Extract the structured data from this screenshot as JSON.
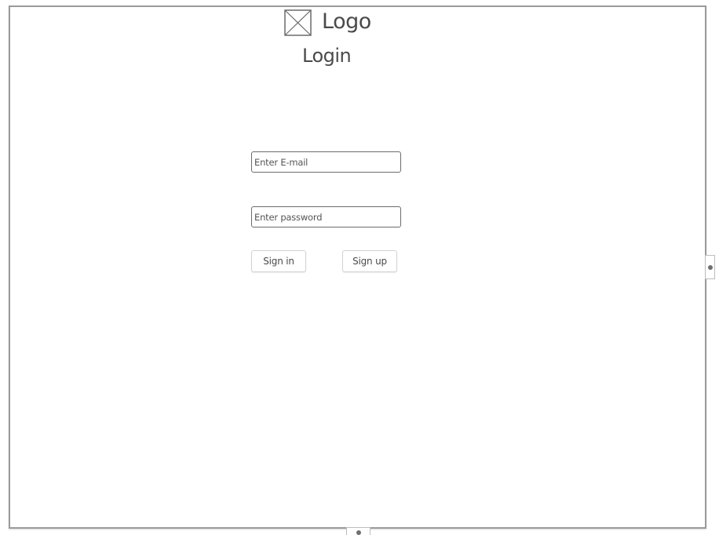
{
  "header": {
    "logo_text": "Logo",
    "title": "Login"
  },
  "form": {
    "email_placeholder": "Enter E-mail",
    "password_placeholder": "Enter password",
    "sign_in_label": "Sign in",
    "sign_up_label": "Sign up"
  }
}
